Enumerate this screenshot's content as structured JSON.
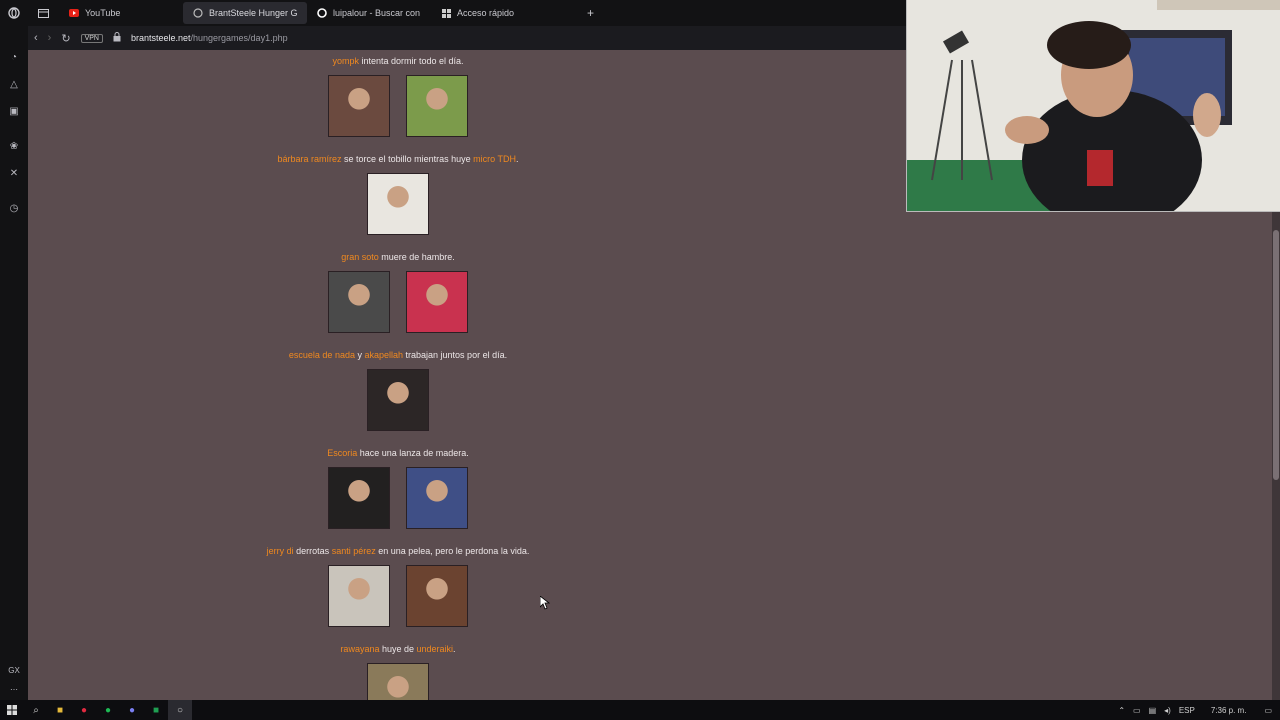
{
  "browser": {
    "tabs": [
      {
        "label": "YouTube",
        "icon": "youtube-icon"
      },
      {
        "label": "BrantSteele Hunger Games",
        "icon": "page-icon",
        "active": true
      },
      {
        "label": "luipalour - Buscar con Google",
        "icon": "google-icon"
      },
      {
        "label": "Acceso rápido",
        "icon": "grid-icon"
      }
    ],
    "new_tab": "+",
    "vpn_label": "VPN",
    "url_host": "brantsteele.net",
    "url_path": "/hungergames/day1.php"
  },
  "events": [
    {
      "parts": [
        {
          "t": "yompk",
          "name": true
        },
        {
          "t": " intenta dormir todo el día.",
          "name": false
        }
      ],
      "pics": 2
    },
    {
      "parts": [
        {
          "t": "bárbara ramírez",
          "name": true
        },
        {
          "t": " se torce el tobillo mientras huye ",
          "name": false
        },
        {
          "t": "micro TDH",
          "name": true
        },
        {
          "t": ".",
          "name": false
        }
      ],
      "pics": 1
    },
    {
      "parts": [
        {
          "t": "gran soto",
          "name": true
        },
        {
          "t": " muere de hambre.",
          "name": false
        }
      ],
      "pics": 2
    },
    {
      "parts": [
        {
          "t": "escuela de nada",
          "name": true
        },
        {
          "t": " y ",
          "name": false
        },
        {
          "t": "akapellah",
          "name": true
        },
        {
          "t": " trabajan juntos por el día.",
          "name": false
        }
      ],
      "pics": 1
    },
    {
      "parts": [
        {
          "t": "Escoria",
          "name": true
        },
        {
          "t": " hace una lanza de madera.",
          "name": false
        }
      ],
      "pics": 2
    },
    {
      "parts": [
        {
          "t": "jerry di",
          "name": true
        },
        {
          "t": " derrotas ",
          "name": false
        },
        {
          "t": "santi pérez",
          "name": true
        },
        {
          "t": " en una pelea, pero le perdona la vida.",
          "name": false
        }
      ],
      "pics": 2
    },
    {
      "parts": [
        {
          "t": "rawayana",
          "name": true
        },
        {
          "t": " huye de ",
          "name": false
        },
        {
          "t": "underaiki",
          "name": true
        },
        {
          "t": ".",
          "name": false
        }
      ],
      "pics": 1
    }
  ],
  "taskbar": {
    "language": "ESP",
    "clock": "7:36 p. m."
  },
  "colors": {
    "page_bg": "#5b4c4f",
    "name_color": "#f0891f",
    "text_color": "#ece6e7"
  }
}
